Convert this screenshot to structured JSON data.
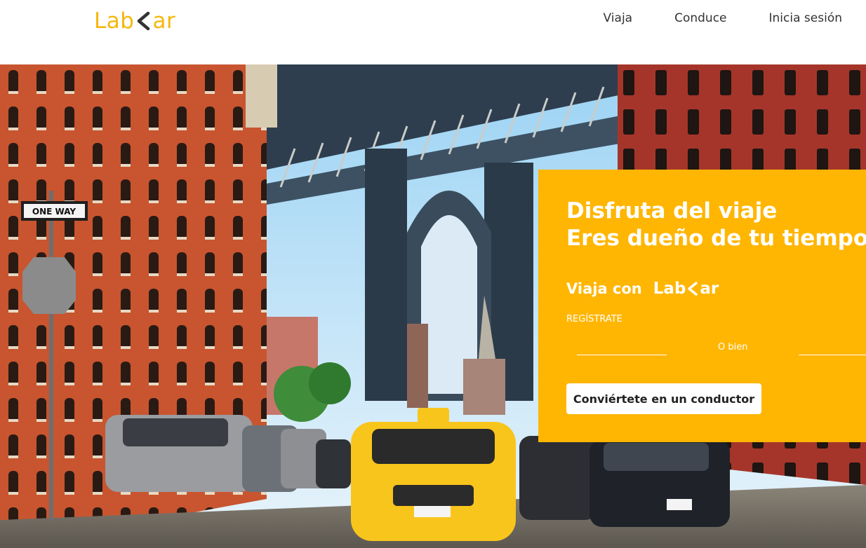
{
  "brand": {
    "logo_left": "Lab",
    "logo_right": "ar",
    "accent_color": "#f6b70f",
    "panel_color": "#ffb602"
  },
  "nav": {
    "items": [
      {
        "label": "Viaja"
      },
      {
        "label": "Conduce"
      },
      {
        "label": "Inicia sesión"
      }
    ]
  },
  "hero": {
    "scene_description_icon": "city-street-photo",
    "street_signs": [
      "ONE WAY"
    ]
  },
  "panel": {
    "headline_line1": "Disfruta del viaje",
    "headline_line2": "Eres dueño de tu tiempo",
    "viaja_con": "Viaja con",
    "register_link": "REGÍSTRATE",
    "or_text": "O bien",
    "driver_button": "Conviértete en un conductor"
  }
}
